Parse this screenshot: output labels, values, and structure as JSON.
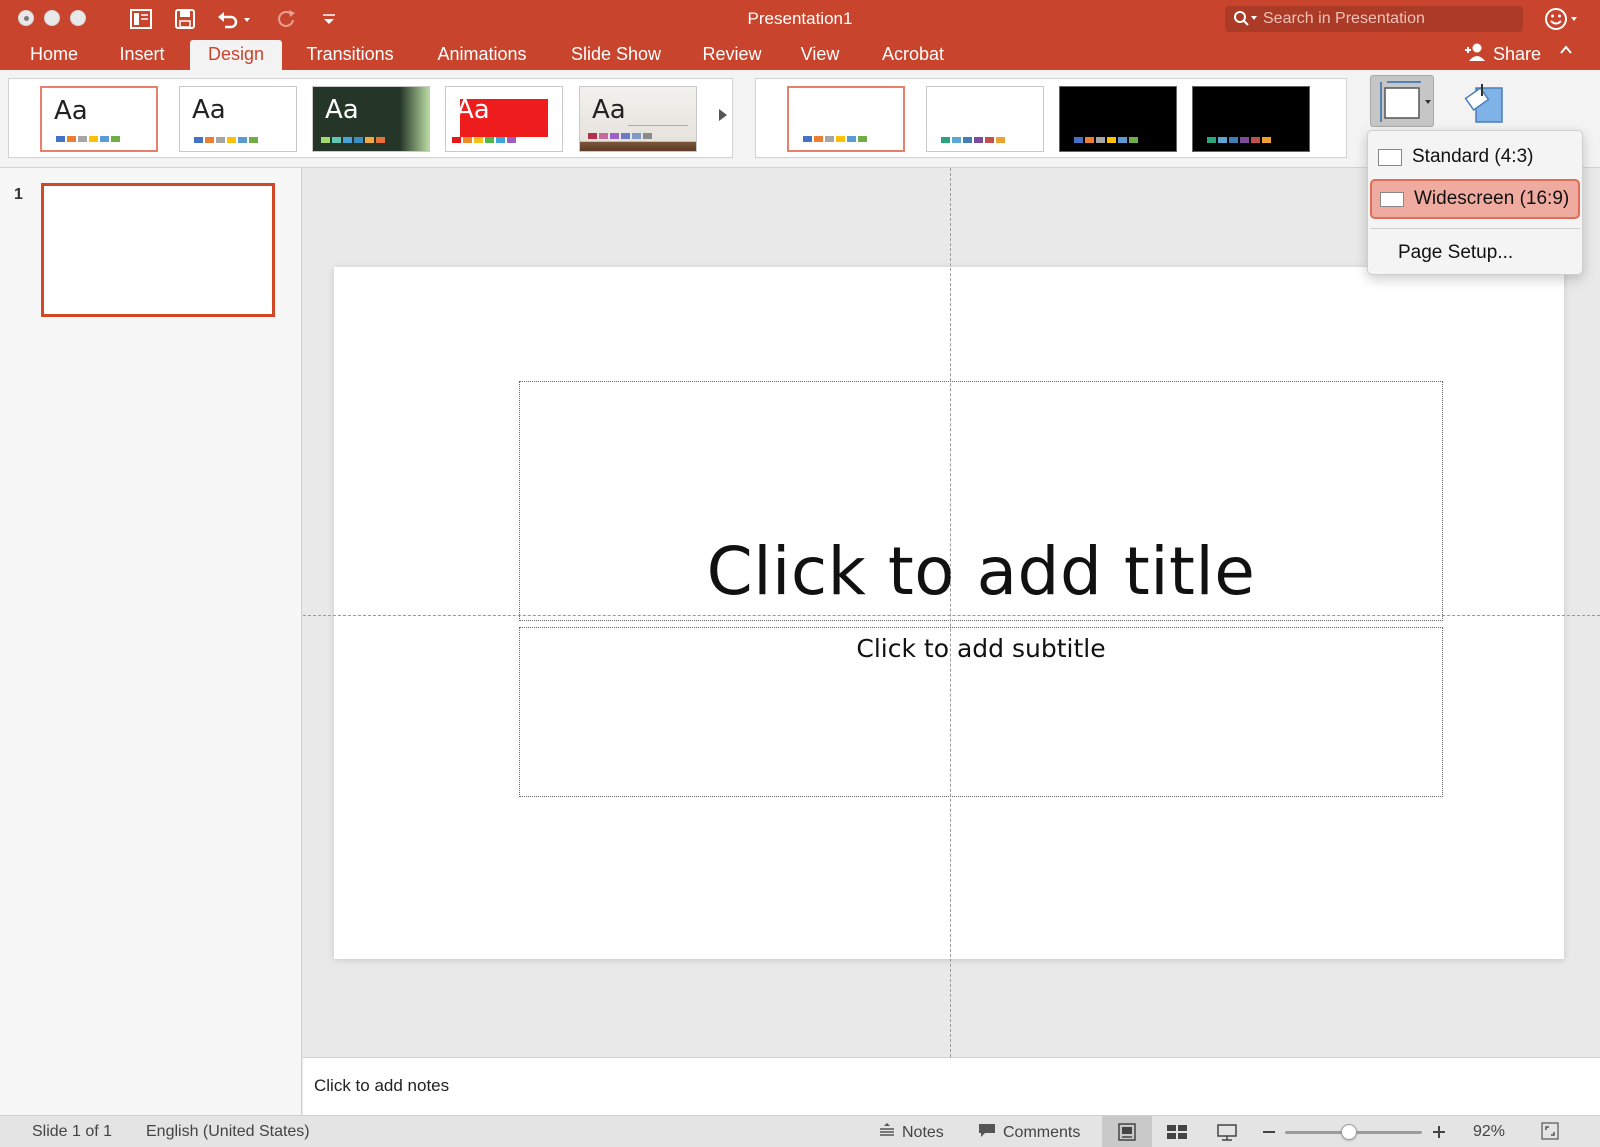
{
  "window": {
    "title": "Presentation1",
    "search_placeholder": "Search in Presentation"
  },
  "tabs": [
    {
      "label": "Home"
    },
    {
      "label": "Insert"
    },
    {
      "label": "Design",
      "active": true
    },
    {
      "label": "Transitions"
    },
    {
      "label": "Animations"
    },
    {
      "label": "Slide Show"
    },
    {
      "label": "Review"
    },
    {
      "label": "View"
    },
    {
      "label": "Acrobat"
    }
  ],
  "share_label": "Share",
  "themes": [
    {
      "aa": "Aa",
      "style": "office",
      "selected": true
    },
    {
      "aa": "Aa",
      "style": "office2"
    },
    {
      "aa": "Aa",
      "style": "dark-green"
    },
    {
      "aa": "Aa",
      "style": "red"
    },
    {
      "aa": "Aa",
      "style": "wood"
    }
  ],
  "variants": [
    {
      "style": "light",
      "selected": true
    },
    {
      "style": "light"
    },
    {
      "style": "dark"
    },
    {
      "style": "dark"
    }
  ],
  "colors": {
    "accent": "#c8442d",
    "selection": "#e67f6b",
    "highlight": "#f0aba0"
  },
  "slide_pane": {
    "slide_number": "1"
  },
  "slide": {
    "title_placeholder": "Click to add title",
    "subtitle_placeholder": "Click to add subtitle"
  },
  "notes_placeholder": "Click to add notes",
  "slide_size_menu": {
    "items": [
      {
        "label": "Standard (4:3)"
      },
      {
        "label": "Widescreen (16:9)",
        "highlighted": true
      },
      {
        "label": "Page Setup..."
      }
    ]
  },
  "status": {
    "slide_info": "Slide 1 of 1",
    "language": "English (United States)",
    "notes_label": "Notes",
    "comments_label": "Comments",
    "zoom": "92%"
  }
}
